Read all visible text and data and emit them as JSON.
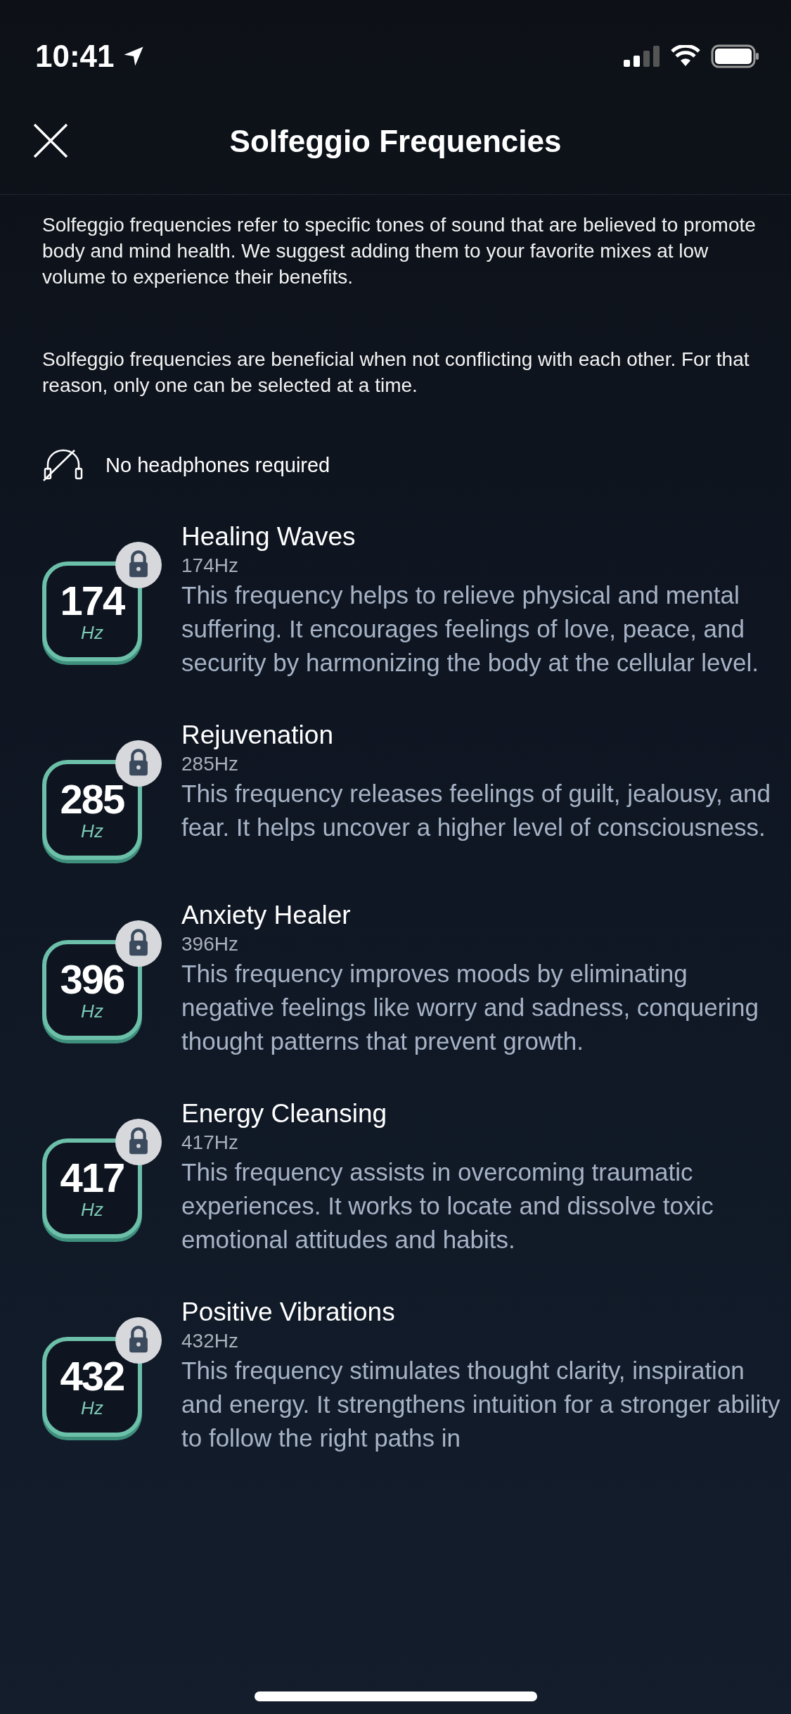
{
  "status_bar": {
    "time": "10:41"
  },
  "header": {
    "title": "Solfeggio Frequencies"
  },
  "intro": [
    "Solfeggio frequencies refer to specific tones of sound that are believed to promote body and mind health. We suggest adding them to your favorite mixes at low volume to experience their benefits.",
    "Solfeggio frequencies are beneficial when not conflicting with each other. For that reason, only one can be selected at a time."
  ],
  "headphones_note": "No headphones required",
  "frequencies": [
    {
      "number": "174",
      "unit": "Hz",
      "locked": true,
      "title": "Healing Waves",
      "hz": "174Hz",
      "description": "This frequency helps to relieve physical and mental suffering. It encourages feelings of love, peace, and security by harmonizing the body at the cellular level."
    },
    {
      "number": "285",
      "unit": "Hz",
      "locked": true,
      "title": "Rejuvenation",
      "hz": "285Hz",
      "description": "This frequency releases feelings of guilt, jealousy, and fear. It helps uncover a higher level of consciousness."
    },
    {
      "number": "396",
      "unit": "Hz",
      "locked": true,
      "title": "Anxiety Healer",
      "hz": "396Hz",
      "description": "This frequency improves moods by eliminating negative feelings like worry and sadness, conquering thought patterns that prevent growth."
    },
    {
      "number": "417",
      "unit": "Hz",
      "locked": true,
      "title": "Energy Cleansing",
      "hz": "417Hz",
      "description": "This frequency assists in overcoming traumatic experiences. It works to locate and dissolve toxic emotional attitudes and habits."
    },
    {
      "number": "432",
      "unit": "Hz",
      "locked": true,
      "title": "Positive Vibrations",
      "hz": "432Hz",
      "description": "This frequency stimulates thought clarity, inspiration and energy. It strengthens intuition for a stronger ability to follow the right paths in"
    }
  ]
}
